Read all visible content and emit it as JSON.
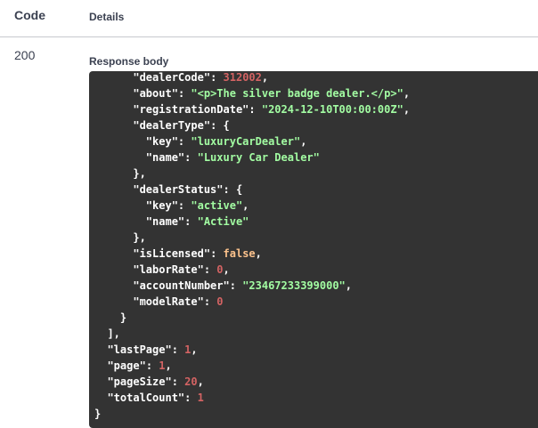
{
  "table": {
    "code_header": "Code",
    "details_header": "Details"
  },
  "response": {
    "status_code": "200",
    "body_label": "Response body",
    "lines": [
      {
        "indent": "      ",
        "key": "\"dealerCode\"",
        "value": "312002",
        "vtype": "n",
        "trail": ","
      },
      {
        "indent": "      ",
        "key": "\"about\"",
        "value": "\"<p>The silver badge dealer.</p>\"",
        "vtype": "s",
        "trail": ","
      },
      {
        "indent": "      ",
        "key": "\"registrationDate\"",
        "value": "\"2024-12-10T00:00:00Z\"",
        "vtype": "s",
        "trail": ","
      },
      {
        "indent": "      ",
        "key": "\"dealerType\"",
        "value": "",
        "vtype": "p",
        "trail": " {"
      },
      {
        "indent": "        ",
        "key": "\"key\"",
        "value": "\"luxuryCarDealer\"",
        "vtype": "s",
        "trail": ","
      },
      {
        "indent": "        ",
        "key": "\"name\"",
        "value": "\"Luxury Car Dealer\"",
        "vtype": "s",
        "trail": ""
      },
      {
        "indent": "      ",
        "key": "",
        "value": "",
        "vtype": "p",
        "trail": "},"
      },
      {
        "indent": "      ",
        "key": "\"dealerStatus\"",
        "value": "",
        "vtype": "p",
        "trail": " {"
      },
      {
        "indent": "        ",
        "key": "\"key\"",
        "value": "\"active\"",
        "vtype": "s",
        "trail": ","
      },
      {
        "indent": "        ",
        "key": "\"name\"",
        "value": "\"Active\"",
        "vtype": "s",
        "trail": ""
      },
      {
        "indent": "      ",
        "key": "",
        "value": "",
        "vtype": "p",
        "trail": "},"
      },
      {
        "indent": "      ",
        "key": "\"isLicensed\"",
        "value": "false",
        "vtype": "b",
        "trail": ","
      },
      {
        "indent": "      ",
        "key": "\"laborRate\"",
        "value": "0",
        "vtype": "n",
        "trail": ","
      },
      {
        "indent": "      ",
        "key": "\"accountNumber\"",
        "value": "\"23467233399000\"",
        "vtype": "s",
        "trail": ","
      },
      {
        "indent": "      ",
        "key": "\"modelRate\"",
        "value": "0",
        "vtype": "n",
        "trail": ""
      },
      {
        "indent": "    ",
        "key": "",
        "value": "",
        "vtype": "p",
        "trail": "}"
      },
      {
        "indent": "  ",
        "key": "",
        "value": "",
        "vtype": "p",
        "trail": "],"
      },
      {
        "indent": "  ",
        "key": "\"lastPage\"",
        "value": "1",
        "vtype": "n",
        "trail": ","
      },
      {
        "indent": "  ",
        "key": "\"page\"",
        "value": "1",
        "vtype": "n",
        "trail": ","
      },
      {
        "indent": "  ",
        "key": "\"pageSize\"",
        "value": "20",
        "vtype": "n",
        "trail": ","
      },
      {
        "indent": "  ",
        "key": "\"totalCount\"",
        "value": "1",
        "vtype": "n",
        "trail": ""
      },
      {
        "indent": "",
        "key": "",
        "value": "",
        "vtype": "p",
        "trail": "}"
      }
    ]
  }
}
